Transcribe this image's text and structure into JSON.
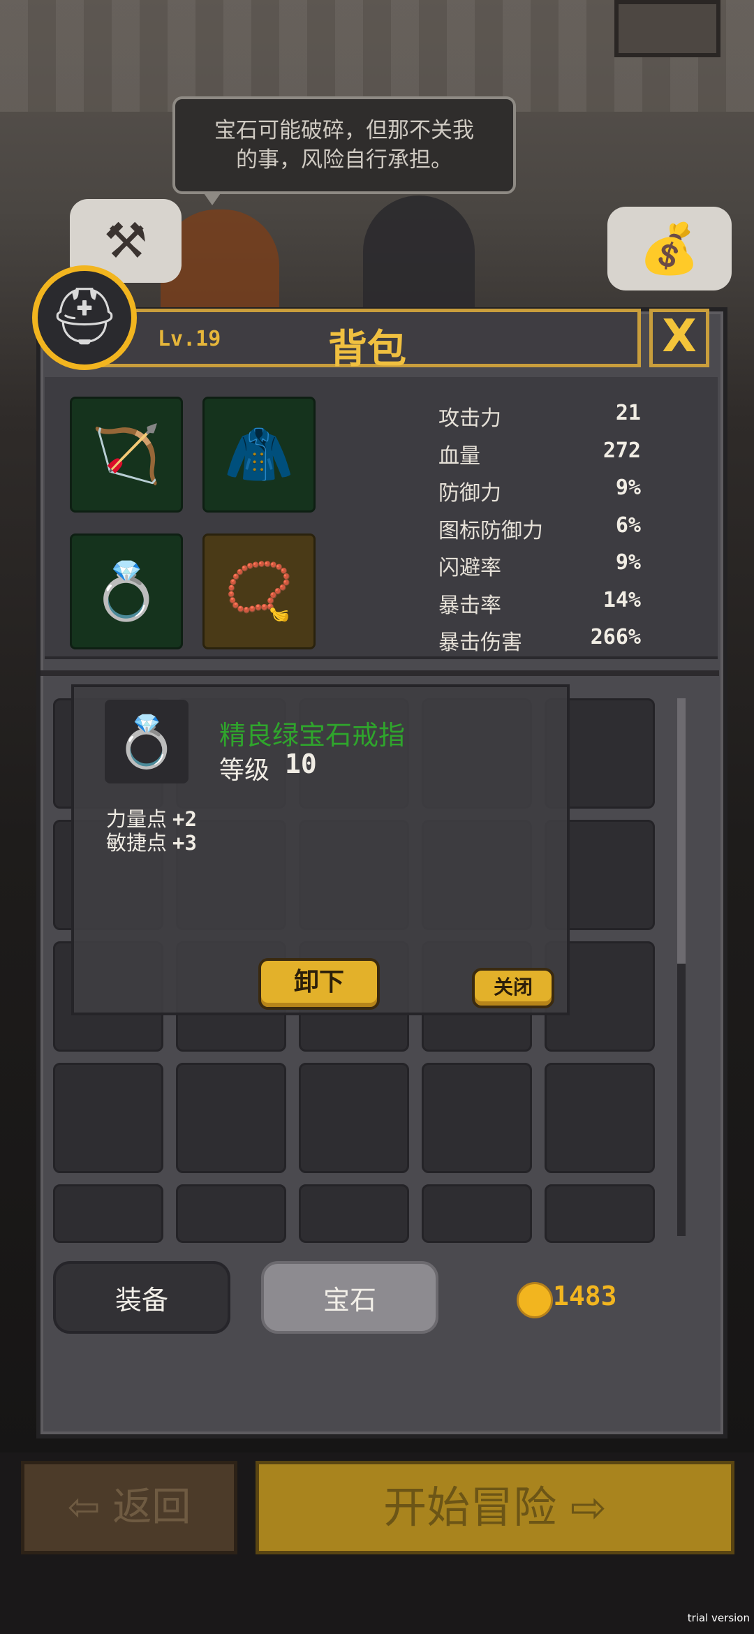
{
  "bubble": {
    "line1": "宝石可能破碎，但那不关我",
    "line2": "的事，风险自行承担。"
  },
  "icons": {
    "hammer": "hammer-icon",
    "bag": "coin-bag-icon",
    "helmet": "helmet-icon",
    "crossbow": "crossbow-icon",
    "cloak": "cloak-icon",
    "ring": "emerald-ring-icon",
    "amulet": "emerald-amulet-icon",
    "coin": "gold-coin-icon",
    "exit": "exit-icon",
    "start": "start-adventure-icon"
  },
  "header": {
    "level": "Lv.19",
    "title": "背包",
    "close": "X"
  },
  "stats": [
    {
      "label": "攻击力",
      "value": "21"
    },
    {
      "label": "血量",
      "value": "272"
    },
    {
      "label": "防御力",
      "value": "9%"
    },
    {
      "label": "图标防御力",
      "value": "6%"
    },
    {
      "label": "闪避率",
      "value": "9%"
    },
    {
      "label": "暴击率",
      "value": "14%"
    },
    {
      "label": "暴击伤害",
      "value": "266%"
    }
  ],
  "tooltip": {
    "item_name": "精良绿宝石戒指",
    "level_label": "等级",
    "level_value": "10",
    "attributes": [
      {
        "label": "力量点",
        "value": "+2"
      },
      {
        "label": "敏捷点",
        "value": "+3"
      }
    ],
    "unequip_label": "卸下",
    "close_label": "关闭"
  },
  "tabs": {
    "equipment": "装备",
    "gems": "宝石"
  },
  "gold": "1483",
  "footer": {
    "back": "返回",
    "start": "开始冒险"
  },
  "watermark": "trial version",
  "colors": {
    "accent_gold": "#f2b51f",
    "item_rare_green": "#2fa52c"
  }
}
